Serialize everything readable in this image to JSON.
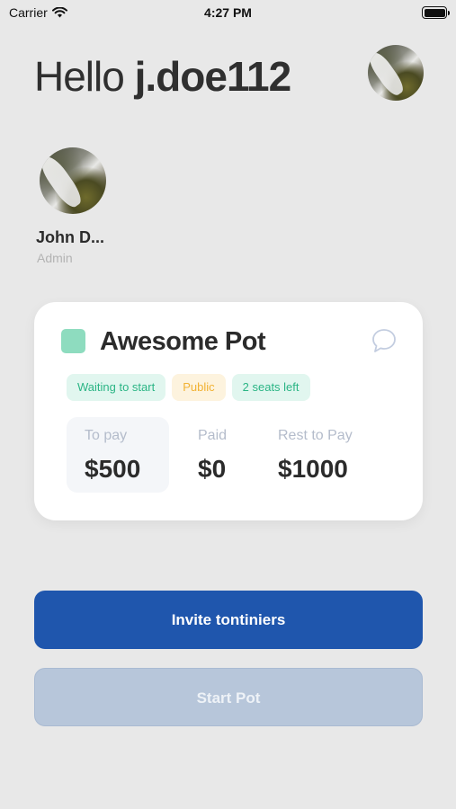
{
  "status_bar": {
    "carrier": "Carrier",
    "time": "4:27 PM"
  },
  "header": {
    "greeting": "Hello",
    "username": "j.doe112"
  },
  "members": [
    {
      "name": "John D...",
      "role": "Admin"
    }
  ],
  "pot": {
    "title": "Awesome Pot",
    "color": "#8edcbf",
    "badges": [
      "Waiting to start",
      "Public",
      "2 seats left"
    ],
    "stats": {
      "to_pay": {
        "label": "To pay",
        "value": "$500"
      },
      "paid": {
        "label": "Paid",
        "value": "$0"
      },
      "rest": {
        "label": "Rest to Pay",
        "value": "$1000"
      }
    }
  },
  "actions": {
    "invite": "Invite tontiniers",
    "start": "Start Pot"
  },
  "colors": {
    "primary": "#1f56ad",
    "disabled": "#b7c6da",
    "success": "#2bb585",
    "warning": "#f2b233"
  },
  "icons": [
    "wifi-icon",
    "battery-icon",
    "chat-bubble-icon"
  ]
}
